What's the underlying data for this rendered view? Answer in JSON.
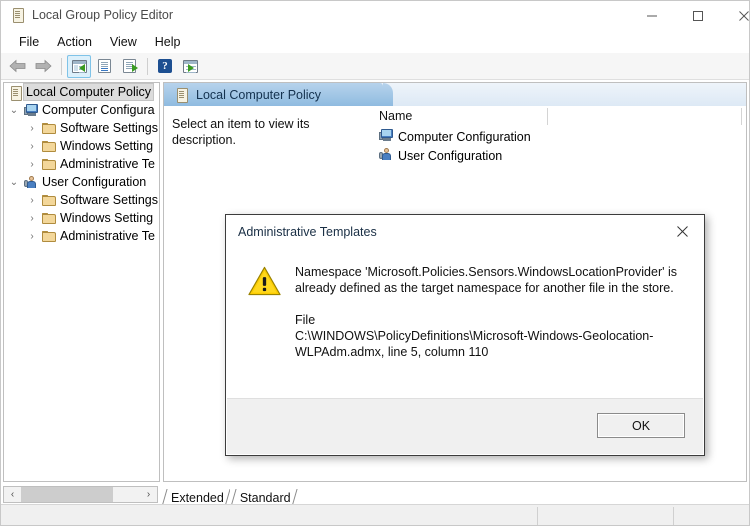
{
  "window": {
    "title": "Local Group Policy Editor",
    "icon": "scroll-icon",
    "minimize_label": "—",
    "maximize_label": "□",
    "close_label": "✕"
  },
  "menu": {
    "items": [
      {
        "label": "File"
      },
      {
        "label": "Action"
      },
      {
        "label": "View"
      },
      {
        "label": "Help"
      }
    ]
  },
  "toolbar": {
    "buttons": [
      {
        "name": "back-button",
        "icon": "back-arrow-icon"
      },
      {
        "name": "forward-button",
        "icon": "forward-arrow-icon"
      },
      {
        "name": "show-hide-tree-button",
        "icon": "console-tree-icon"
      },
      {
        "name": "properties-button",
        "icon": "properties-icon"
      },
      {
        "name": "export-list-button",
        "icon": "export-list-icon"
      },
      {
        "name": "help-button",
        "icon": "help-icon"
      },
      {
        "name": "show-hide-action-pane-button",
        "icon": "action-pane-icon"
      }
    ]
  },
  "tree": {
    "items": [
      {
        "label": "Local Computer Policy",
        "icon": "scroll-icon",
        "depth": 0,
        "twisty": "",
        "selected": true
      },
      {
        "label": "Computer Configura",
        "icon": "computer-icon",
        "depth": 1,
        "twisty": "⌄",
        "selected": false
      },
      {
        "label": "Software Settings",
        "icon": "folder-icon",
        "depth": 2,
        "twisty": "›",
        "selected": false
      },
      {
        "label": "Windows Setting",
        "icon": "folder-icon",
        "depth": 2,
        "twisty": "›",
        "selected": false
      },
      {
        "label": "Administrative Te",
        "icon": "folder-icon",
        "depth": 2,
        "twisty": "›",
        "selected": false
      },
      {
        "label": "User Configuration",
        "icon": "user-icon",
        "depth": 1,
        "twisty": "⌄",
        "selected": false
      },
      {
        "label": "Software Settings",
        "icon": "folder-icon",
        "depth": 2,
        "twisty": "›",
        "selected": false
      },
      {
        "label": "Windows Setting",
        "icon": "folder-icon",
        "depth": 2,
        "twisty": "›",
        "selected": false
      },
      {
        "label": "Administrative Te",
        "icon": "folder-icon",
        "depth": 2,
        "twisty": "›",
        "selected": false
      }
    ]
  },
  "result_pane": {
    "tab_label": "Local Computer Policy",
    "tab_icon": "scroll-icon",
    "description": "Select an item to view its description.",
    "columns": [
      "Name"
    ],
    "rows": [
      {
        "name": "Computer Configuration",
        "icon": "computer-icon"
      },
      {
        "name": "User Configuration",
        "icon": "user-icon"
      }
    ]
  },
  "bottom_tabs": {
    "tabs": [
      {
        "label": "Extended",
        "active": false
      },
      {
        "label": "Standard",
        "active": true
      }
    ]
  },
  "hscrollbar": {
    "left_arrow": "‹",
    "right_arrow": "›"
  },
  "dialog": {
    "title": "Administrative Templates",
    "close_label": "✕",
    "icon": "warning-icon",
    "message": "Namespace 'Microsoft.Policies.Sensors.WindowsLocationProvider' is already defined as the target namespace for another file in the store.",
    "file_label": "File",
    "file_path": "C:\\WINDOWS\\PolicyDefinitions\\Microsoft-Windows-Geolocation-WLPAdm.admx, line 5, column 110",
    "ok_label": "OK"
  },
  "colors": {
    "tab_blue": "#8fbbe0",
    "warning_yellow": "#ffcc00",
    "help_blue": "#1d4f91",
    "selection_gray": "#dcdcdc"
  }
}
